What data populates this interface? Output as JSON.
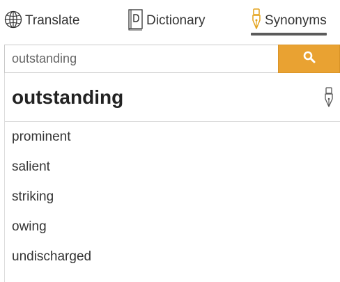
{
  "tabs": {
    "translate": {
      "label": "Translate",
      "icon": "globe-icon"
    },
    "dictionary": {
      "label": "Dictionary",
      "icon": "dictionary-book-icon"
    },
    "synonyms": {
      "label": "Synonyms",
      "icon": "pen-nib-icon",
      "active": true
    }
  },
  "search": {
    "value": "outstanding",
    "button_icon": "search-icon"
  },
  "result": {
    "headword": "outstanding",
    "headword_icon": "pen-nib-icon",
    "synonyms": [
      "prominent",
      "salient",
      "striking",
      "owing",
      "undischarged"
    ]
  },
  "colors": {
    "accent": "#e9a232",
    "active_underline": "#5b5b5b",
    "icon_gold": "#e3a21a"
  }
}
